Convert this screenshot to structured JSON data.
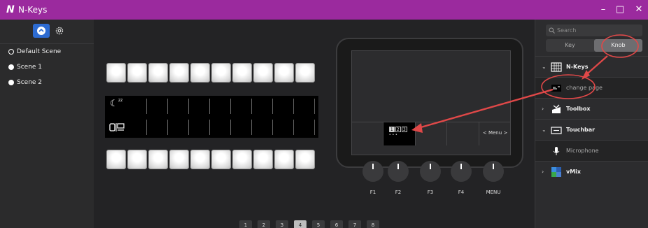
{
  "window": {
    "logo": "N",
    "title": "N-Keys",
    "controls": [
      "–",
      "□",
      "✕"
    ]
  },
  "left_panel": {
    "tabs": [
      "scenes-icon",
      "settings-icon"
    ],
    "scenes": [
      {
        "label": "Default Scene",
        "selected": true
      },
      {
        "label": "Scene 1",
        "selected": false
      },
      {
        "label": "Scene 2",
        "selected": false
      }
    ]
  },
  "canvas": {
    "lcd_icons": [
      "moon-sleep-icon",
      "screen-switch-icon"
    ],
    "touchbar": {
      "selected_cell_icon": "page-switch-icon",
      "page_numbers": [
        "1",
        "2",
        "3"
      ],
      "page_dots": "• • •",
      "menu_label": "< Menu >"
    },
    "knobs": [
      "F1",
      "F2",
      "F3",
      "F4",
      "MENU"
    ],
    "pages": [
      "1",
      "2",
      "3",
      "4",
      "5",
      "6",
      "7",
      "8"
    ],
    "active_page": "4"
  },
  "library": {
    "search_placeholder": "Search",
    "tabs": [
      "Key",
      "Knob"
    ],
    "active_tab": "Knob",
    "groups": [
      {
        "label": "N-Keys",
        "expanded": true,
        "icon": "grid-keyboard-icon"
      },
      {
        "label": "change page",
        "child": true,
        "icon": "page-switch-icon"
      },
      {
        "label": "Toolbox",
        "expanded": false,
        "icon": "toolbox-icon"
      },
      {
        "label": "Touchbar",
        "expanded": true,
        "icon": "touchbar-icon"
      },
      {
        "label": "Microphone",
        "child": true,
        "icon": "microphone-icon"
      },
      {
        "label": "vMix",
        "expanded": false,
        "icon": "vmix-icon"
      }
    ]
  },
  "colors": {
    "titlebar": "#9b2a9e",
    "accent": "#2d6bd1",
    "annotation": "#e04848"
  }
}
